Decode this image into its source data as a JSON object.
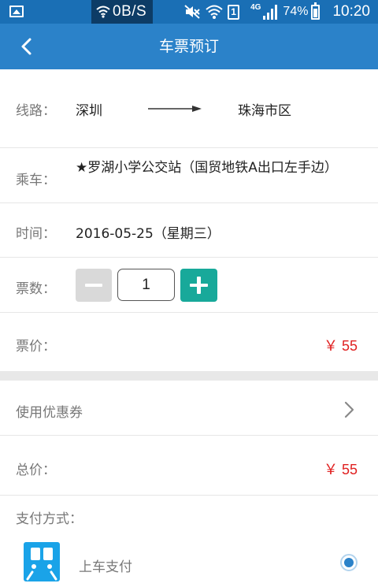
{
  "status_bar": {
    "net_speed": "0B/S",
    "network": "4G",
    "sim_slot": "1",
    "battery": "74%",
    "time": "10:20",
    "color": "#1a6fb5"
  },
  "header": {
    "title": "车票预订",
    "back_icon": "chevron-left-icon",
    "color": "#2b82c9"
  },
  "route": {
    "label": "线路：",
    "from": "深圳",
    "to": "珠海市区",
    "arrow_icon": "arrow-right-icon"
  },
  "boarding": {
    "label": "乘车：",
    "value": "★罗湖小学公交站（国贸地铁A出口左手边）"
  },
  "time": {
    "label": "时间：",
    "value": "2016-05-25（星期三）"
  },
  "quantity": {
    "label": "票数：",
    "value": "1",
    "minus_icon": "minus-icon",
    "plus_icon": "plus-icon",
    "plus_color": "#18a99a"
  },
  "price": {
    "label": "票价：",
    "value": "￥ 55",
    "color": "#e02020"
  },
  "coupon": {
    "label": "使用优惠券",
    "chevron_icon": "chevron-right-icon"
  },
  "total": {
    "label": "总价：",
    "value": "￥ 55"
  },
  "payment": {
    "heading": "支付方式：",
    "options": [
      {
        "label": "上车支付",
        "icon": "bus-icon",
        "selected": true
      }
    ]
  }
}
